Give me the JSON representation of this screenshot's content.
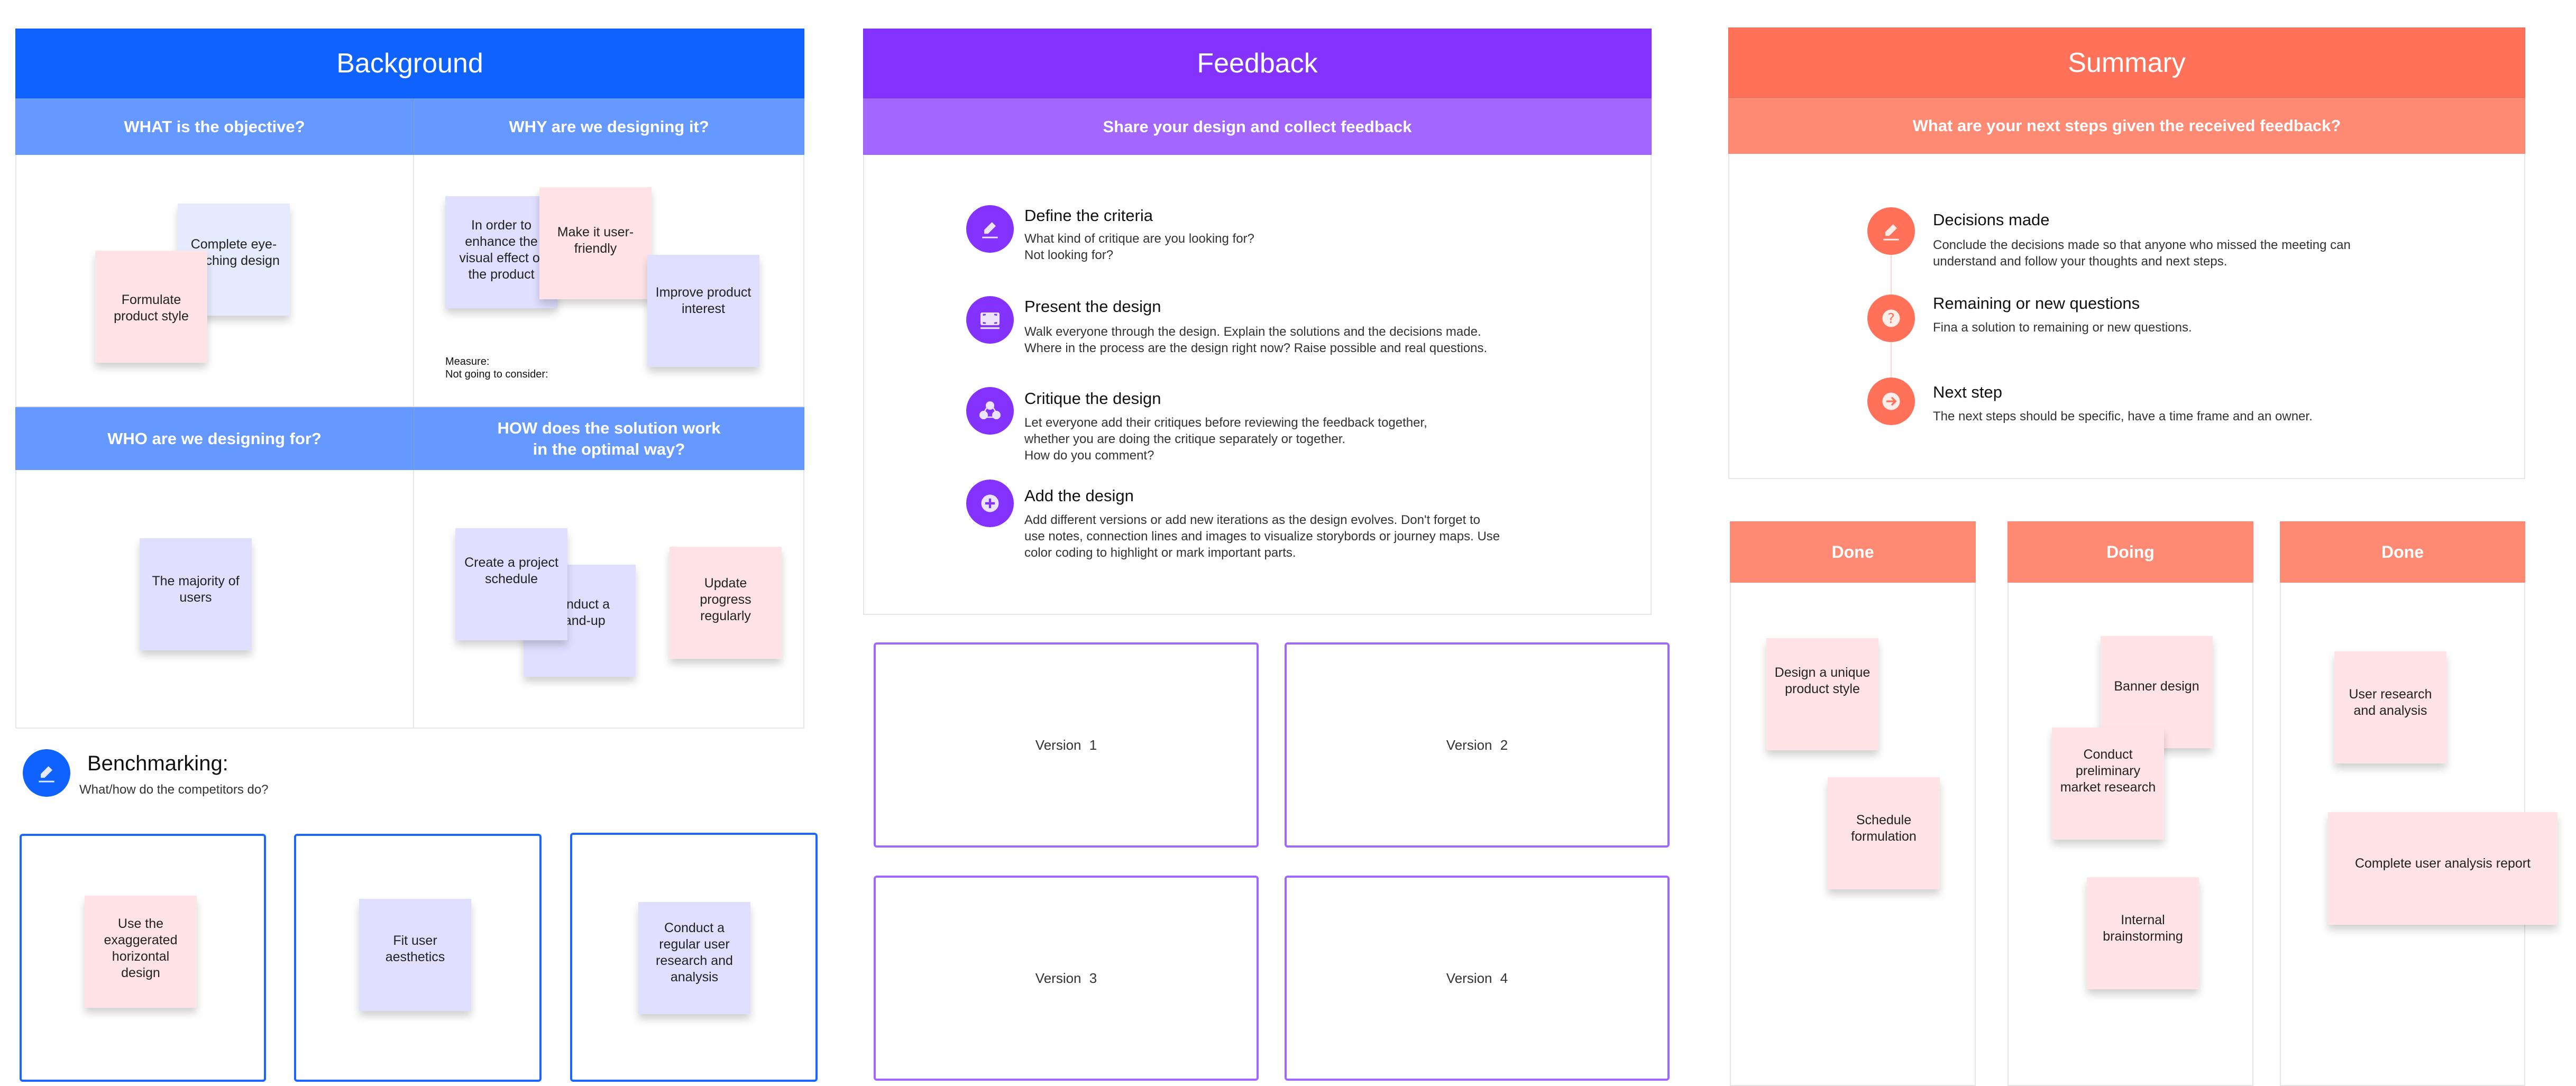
{
  "colors": {
    "background_primary": "#0f62fe",
    "background_secondary": "#6699ff",
    "feedback_primary": "#8433ff",
    "feedback_secondary": "#a366ff",
    "summary_primary": "#ff7159",
    "summary_secondary": "#ff8a73",
    "sticky_pink": "#ffe3e6",
    "sticky_lavender": "#e0dfff",
    "sticky_ice": "#e5ebfd"
  },
  "background": {
    "title": "Background",
    "quadrants": [
      {
        "header": "WHAT is the objective?",
        "stickies": [
          "Complete eye-catching design",
          "Formulate product style"
        ]
      },
      {
        "header": "WHY are we designing it?",
        "stickies": [
          "In order to enhance the visual effect of the product",
          "Make it user-friendly",
          "Improve product interest"
        ],
        "notes": [
          "Measure:",
          "Not going to consider:"
        ]
      },
      {
        "header": "WHO are we designing for?",
        "stickies": [
          "The majority of users"
        ]
      },
      {
        "header": "HOW does the solution work in the optimal way?",
        "stickies": [
          "Conduct a stand-up",
          "Create a project schedule",
          "Update progress regularly"
        ]
      }
    ],
    "benchmarking": {
      "icon": "pencil-icon",
      "title": "Benchmarking:",
      "subtitle": "What/how do the competitors do?",
      "boxes": [
        {
          "sticky": "Use the exaggerated horizontal design"
        },
        {
          "sticky": "Fit user aesthetics"
        },
        {
          "sticky": "Conduct a regular user research and analysis"
        }
      ]
    }
  },
  "feedback": {
    "title": "Feedback",
    "subtitle": "Share your design and collect feedback",
    "steps": [
      {
        "icon": "pencil-icon",
        "title": "Define the criteria",
        "body": "What kind of critique are you looking for?\nNot looking for?"
      },
      {
        "icon": "present-screen-icon",
        "title": "Present the design",
        "body": "Walk everyone through the design. Explain the solutions and the decisions made.\nWhere in the process are the design right now? Raise possible and real questions."
      },
      {
        "icon": "people-network-icon",
        "title": "Critique the design",
        "body": "Let everyone add their critiques before reviewing the feedback together,\nwhether you are doing the critique separately or together.\nHow do you comment?"
      },
      {
        "icon": "plus-circle-icon",
        "title": "Add the design",
        "body": "Add different versions or add new iterations as the design evolves. Don't forget to\nuse notes, connection lines and images to visualize storybords or journey maps. Use\ncolor coding to highlight or mark important parts."
      }
    ],
    "versions": [
      "Version  1",
      "Version  2",
      "Version  3",
      "Version  4"
    ]
  },
  "summary": {
    "title": "Summary",
    "subtitle": "What are your next steps given the received feedback?",
    "steps": [
      {
        "icon": "pencil-icon",
        "title": "Decisions made",
        "body": "Conclude the decisions made so that anyone who missed the meeting can\nunderstand and follow your thoughts and next steps."
      },
      {
        "icon": "question-circle-icon",
        "title": "Remaining or new questions",
        "body": "Fina a solution to remaining or new questions."
      },
      {
        "icon": "arrow-right-circle-icon",
        "title": "Next step",
        "body": "The next steps should be specific, have a time frame and an owner."
      }
    ],
    "kanban": [
      {
        "header": "Done",
        "stickies": [
          "Design a unique product style",
          "Schedule formulation"
        ]
      },
      {
        "header": "Doing",
        "stickies": [
          "Banner design",
          "Conduct preliminary market research",
          "Internal brainstorming"
        ]
      },
      {
        "header": "Done",
        "stickies": [
          "User research and analysis",
          "Complete user analysis report"
        ]
      }
    ]
  }
}
